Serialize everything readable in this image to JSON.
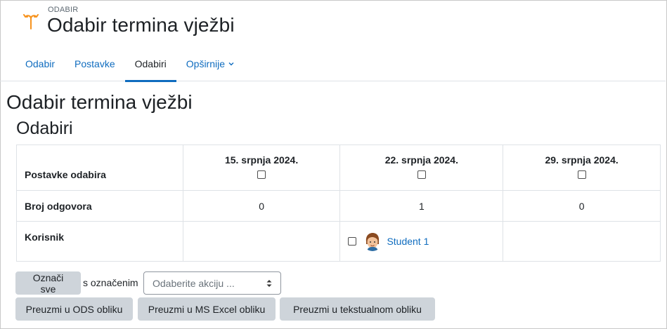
{
  "header": {
    "activity_type": "ODABIR",
    "title": "Odabir termina vježbi"
  },
  "nav": {
    "tabs": [
      {
        "label": "Odabir"
      },
      {
        "label": "Postavke"
      },
      {
        "label": "Odabiri",
        "active": true
      },
      {
        "label": "Opširnije"
      }
    ]
  },
  "main": {
    "title": "Odabir termina vježbi",
    "subtitle": "Odabiri"
  },
  "table": {
    "settings_label": "Postavke odabira",
    "dates": [
      "15. srpnja 2024.",
      "22. srpnja 2024.",
      "29. srpnja 2024."
    ],
    "count_label": "Broj odgovora",
    "counts": [
      "0",
      "1",
      "0"
    ],
    "user_label": "Korisnik",
    "user_name": "Student 1"
  },
  "actions": {
    "select_all": "Označi sve",
    "with_selected": "s označenim",
    "action_placeholder": "Odaberite akciju ...",
    "download_ods": "Preuzmi u ODS obliku",
    "download_excel": "Preuzmi u MS Excel obliku",
    "download_text": "Preuzmi u tekstualnom obliku"
  },
  "colors": {
    "link": "#0f6cbf",
    "text": "#1d2125",
    "button_bg": "#ced4da",
    "border": "#dee2e6",
    "icon_orange": "#f7931e"
  },
  "icons": [
    "choice-activity-icon",
    "chevron-down-icon",
    "student-avatar",
    "select-arrow-icon"
  ]
}
